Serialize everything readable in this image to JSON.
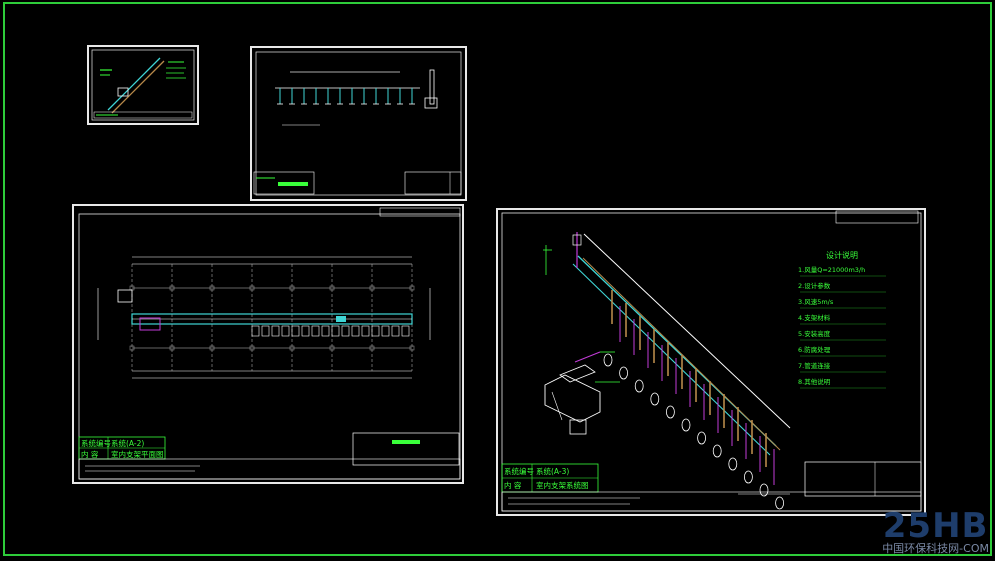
{
  "colors": {
    "frame": "#2ecc3a",
    "sheet_border": "#e8e8e8",
    "line": "#ffffff",
    "annotation": "#39ff3a",
    "pipe": "#3fd6d6",
    "hanger": "#c23bd8",
    "support": "#b88a4a",
    "grid": "#c8c8c8"
  },
  "sheet_small": {
    "title_label": "系统编号",
    "title_value": "系统(A-2)",
    "title_label2": "内  容",
    "title_value2": "室内支架平面图"
  },
  "sheet_large": {
    "title_label": "系统编号",
    "title_value": "系统(A-3)",
    "title_label2": "内  容",
    "title_value2": "室内支架系统图"
  },
  "design_notes": {
    "heading": "设计说明",
    "lines": [
      "1.风量Q=21000m3/h",
      "2.设计参数",
      "3.风速5m/s",
      "4.支架材料",
      "5.安装高度",
      "6.防腐处理",
      "7.管道连接",
      "8.其他说明"
    ]
  },
  "watermark": {
    "logo": "25HB",
    "subtitle": "中国环保科技网-COM"
  }
}
